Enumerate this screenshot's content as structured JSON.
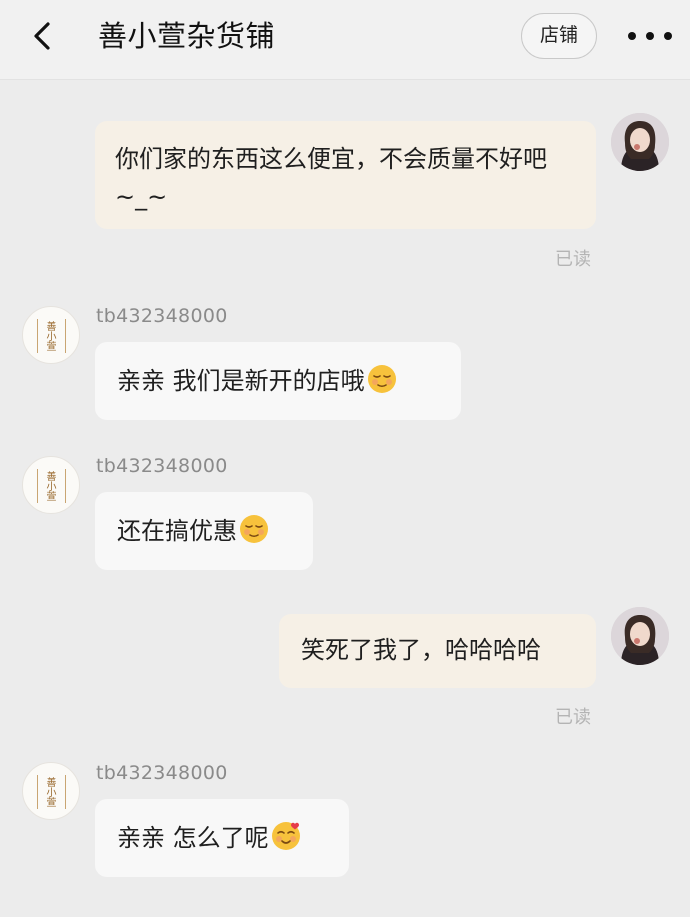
{
  "header": {
    "title": "善小萱杂货铺",
    "shop_button": "店铺",
    "back_icon": "chevron-left-icon",
    "more_icon": "more-horizontal-icon"
  },
  "messages": [
    {
      "from": "me",
      "text": "你们家的东西这么便宜，不会质量不好吧~_~",
      "status": "已读"
    },
    {
      "from": "shop",
      "sender": "tb432348000",
      "text": "亲亲 我们是新开的店哦",
      "emoji": "relieved-face"
    },
    {
      "from": "shop",
      "sender": "tb432348000",
      "text": "还在搞优惠",
      "emoji": "relieved-face"
    },
    {
      "from": "me",
      "text": "笑死了我了，哈哈哈哈",
      "status": "已读"
    },
    {
      "from": "shop",
      "sender": "tb432348000",
      "text": "亲亲 怎么了呢",
      "emoji": "smiling-face-with-hearts"
    }
  ],
  "shop_logo_text": "善小萱",
  "colors": {
    "background": "#ececec",
    "my_bubble": "#f6f0e6",
    "their_bubble": "#f8f8f8",
    "read_text": "#b4b4b4",
    "logo_gold": "#9a6a2e"
  }
}
